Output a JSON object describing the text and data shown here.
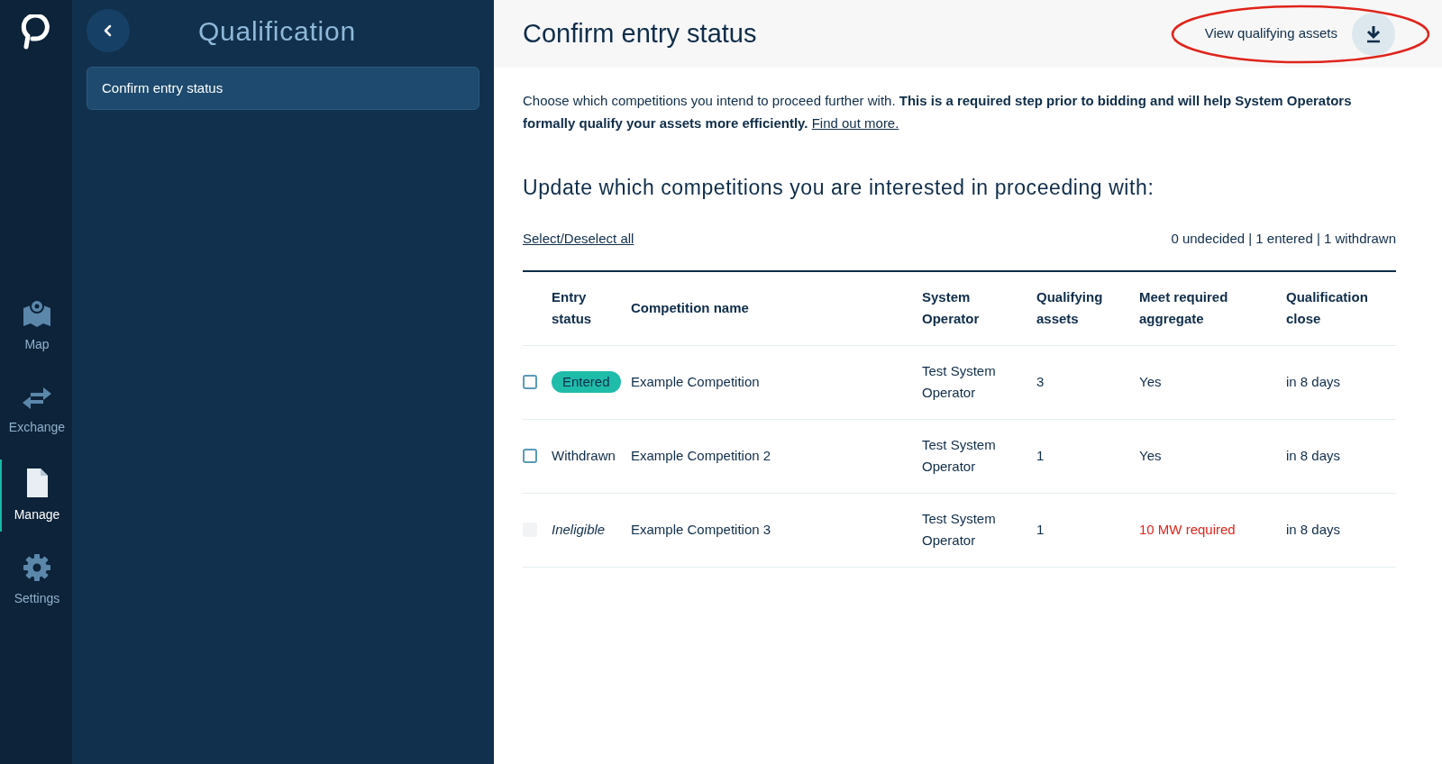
{
  "nav": [
    {
      "label": "Map",
      "kind": "map",
      "selected": false
    },
    {
      "label": "Exchange",
      "kind": "exchange",
      "selected": false
    },
    {
      "label": "Manage",
      "kind": "document",
      "selected": true
    },
    {
      "label": "Settings",
      "kind": "gear",
      "selected": false
    }
  ],
  "sidebar": {
    "title": "Qualification",
    "items": [
      {
        "label": "Confirm entry status",
        "selected": true
      }
    ]
  },
  "header": {
    "title": "Confirm entry status",
    "action": "View qualifying assets"
  },
  "intro": {
    "text": "Choose which competitions you intend to proceed further with. **This is a required step prior to bidding and will help System Operators formally qualify your assets more efficiently.**",
    "link": "Find out more."
  },
  "subheading": "Update which competitions you are interested in proceeding with:",
  "select_all": "Select/Deselect all",
  "summary": "0 undecided | 1 entered | 1 withdrawn",
  "table": {
    "columns": [
      "",
      "Entry status",
      "Competition name",
      "System Operator",
      "Qualifying assets",
      "Meet required aggregate",
      "Qualification close"
    ],
    "rows": [
      {
        "checked": false,
        "disabled": false,
        "status": "Entered",
        "kind": "badge",
        "name": "Example Competition",
        "operator": "Test System Operator",
        "assets": "3",
        "aggregate": "Yes",
        "aggregate_ok": true,
        "close": "in 8 days"
      },
      {
        "checked": false,
        "disabled": false,
        "status": "Withdrawn",
        "kind": "plain",
        "name": "Example Competition 2",
        "operator": "Test System Operator",
        "assets": "1",
        "aggregate": "Yes",
        "aggregate_ok": true,
        "close": "in 8 days"
      },
      {
        "checked": false,
        "disabled": true,
        "status": "Ineligible",
        "kind": "italic",
        "name": "Example Competition 3",
        "operator": "Test System Operator",
        "assets": "1",
        "aggregate": "10 MW required",
        "aggregate_ok": false,
        "close": "in 8 days"
      }
    ]
  }
}
